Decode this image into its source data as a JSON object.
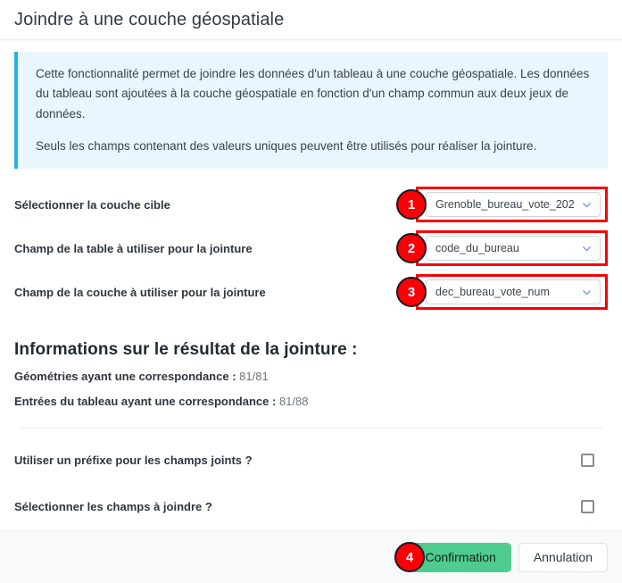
{
  "dialog": {
    "title": "Joindre à une couche géospatiale"
  },
  "info_banner": {
    "paragraph1": "Cette fonctionnalité permet de joindre les données d'un tableau à une couche géospatiale. Les données du tableau sont ajoutées à la couche géospatiale en fonction d'un champ commun aux deux jeux de données.",
    "paragraph2": "Seuls les champs contenant des valeurs uniques peuvent être utilisés pour réaliser la jointure.",
    "accent_color": "#21b3ea",
    "background_color": "#eaf6fd"
  },
  "form": {
    "rows": [
      {
        "label": "Sélectionner la couche cible",
        "badge": "1",
        "value": "Grenoble_bureau_vote_202",
        "icon": "chevron-down-icon"
      },
      {
        "label": "Champ de la table à utiliser pour la jointure",
        "badge": "2",
        "value": "code_du_bureau",
        "icon": "chevron-down-icon"
      },
      {
        "label": "Champ de la couche à utiliser pour la jointure",
        "badge": "3",
        "value": "dec_bureau_vote_num",
        "icon": "chevron-down-icon"
      }
    ]
  },
  "results": {
    "heading": "Informations sur le résultat de la jointure :",
    "lines": [
      {
        "label": "Géométries ayant une correspondance :",
        "value": "81/81"
      },
      {
        "label": "Entrées du tableau ayant une correspondance :",
        "value": "81/88"
      }
    ]
  },
  "options": {
    "checkboxes": [
      {
        "label": "Utiliser un préfixe pour les champs joints ?",
        "checked": false
      },
      {
        "label": "Sélectionner les champs à joindre ?",
        "checked": false
      }
    ]
  },
  "footer": {
    "badge": "4",
    "confirm_label": "Confirmation",
    "cancel_label": "Annulation",
    "confirm_color": "#4ecb8e"
  },
  "annotation": {
    "badge_color": "#fb0007",
    "highlight_color": "#fb0007"
  }
}
